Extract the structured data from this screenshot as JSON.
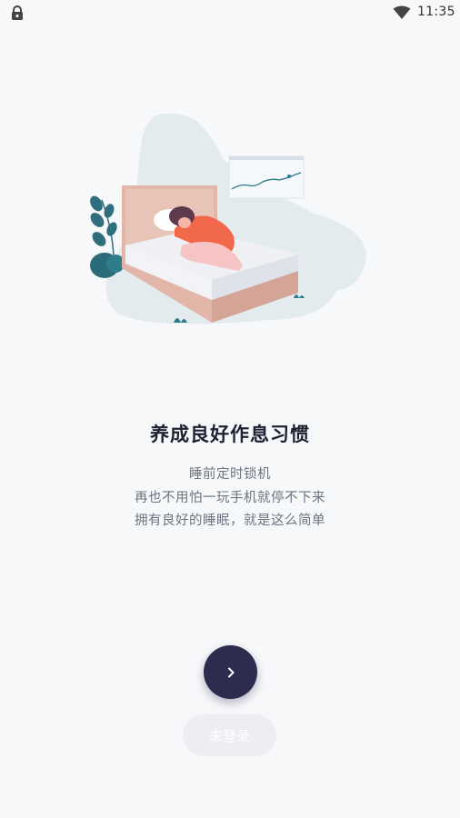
{
  "status_bar": {
    "time": "11:35",
    "left_icon": "lock-icon",
    "right_icon": "wifi-icon"
  },
  "onboarding": {
    "illustration": "person-sleeping-on-bed-illustration",
    "title": "养成良好作息习惯",
    "lines": [
      "睡前定时锁机",
      "再也不用怕一玩手机就停不下来",
      "拥有良好的睡眠，就是这么简单"
    ],
    "next_icon": "chevron-right-icon",
    "login_label": "未登录"
  },
  "colors": {
    "background": "#f7f8fa",
    "accent_dark": "#2b2c4e",
    "title_text": "#1f2133",
    "body_text": "#6c7380"
  }
}
